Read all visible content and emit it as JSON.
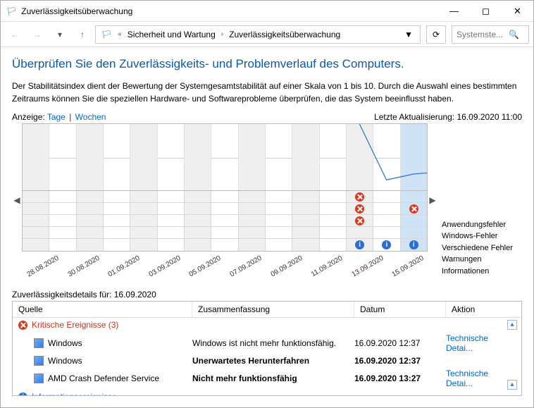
{
  "window": {
    "title": "Zuverlässigkeitsüberwachung"
  },
  "nav": {
    "crumb1": "Sicherheit und Wartung",
    "crumb2": "Zuverlässigkeitsüberwachung",
    "search_placeholder": "Systemste..."
  },
  "page": {
    "heading": "Überprüfen Sie den Zuverlässigkeits- und Problemverlauf des Computers.",
    "desc": "Der Stabilitätsindex dient der Bewertung der Systemgesamtstabilität auf einer Skala von 1 bis 10. Durch die Auswahl eines bestimmten Zeitraums können Sie die speziellen Hardware- und Softwareprobleme überprüfen, die das System beeinflusst haben.",
    "view_label": "Anzeige:",
    "view_days": "Tage",
    "view_weeks": "Wochen",
    "last_update": "Letzte Aktualisierung: 16.09.2020 11:00"
  },
  "chart_data": {
    "type": "line",
    "ylim": [
      1,
      10
    ],
    "yticks": [
      10,
      5,
      1
    ],
    "dates": [
      "28.08.2020",
      "30.08.2020",
      "01.09.2020",
      "03.09.2020",
      "05.09.2020",
      "07.09.2020",
      "09.09.2020",
      "11.09.2020",
      "13.09.2020",
      "15.09.2020"
    ],
    "columns": 15,
    "selected_index": 14,
    "series": [
      {
        "name": "Stabilitätsindex",
        "points": [
          {
            "col": 12,
            "value": 10
          },
          {
            "col": 13,
            "value": 2.4
          },
          {
            "col": 14,
            "value": 3.2
          },
          {
            "col": 15,
            "value": 3.5
          }
        ]
      }
    ],
    "event_rows": [
      {
        "label": "Anwendungsfehler",
        "marks": [
          {
            "col": 12,
            "type": "err"
          }
        ]
      },
      {
        "label": "Windows-Fehler",
        "marks": [
          {
            "col": 12,
            "type": "err"
          },
          {
            "col": 14,
            "type": "err"
          }
        ]
      },
      {
        "label": "Verschiedene Fehler",
        "marks": [
          {
            "col": 12,
            "type": "err"
          }
        ]
      },
      {
        "label": "Warnungen",
        "marks": []
      },
      {
        "label": "Informationen",
        "marks": [
          {
            "col": 12,
            "type": "info"
          },
          {
            "col": 13,
            "type": "info"
          },
          {
            "col": 14,
            "type": "info"
          }
        ]
      }
    ]
  },
  "details": {
    "title": "Zuverlässigkeitsdetails für: 16.09.2020",
    "cols": {
      "c1": "Quelle",
      "c2": "Zusammenfassung",
      "c3": "Datum",
      "c4": "Aktion"
    },
    "group_critical": "Kritische Ereignisse (3)",
    "group_info": "Informationsereignisse",
    "rows": [
      {
        "src": "Windows",
        "sum": "Windows ist nicht mehr funktionsfähig.",
        "date": "16.09.2020 12:37",
        "act": "Technische Detai...",
        "bold": false
      },
      {
        "src": "Windows",
        "sum": "Unerwartetes Herunterfahren",
        "date": "16.09.2020 12:37",
        "act": "",
        "bold": true
      },
      {
        "src": "AMD Crash Defender Service",
        "sum": "Nicht mehr funktionsfähig",
        "date": "16.09.2020 13:27",
        "act": "Technische Detai...",
        "bold": true
      }
    ]
  }
}
